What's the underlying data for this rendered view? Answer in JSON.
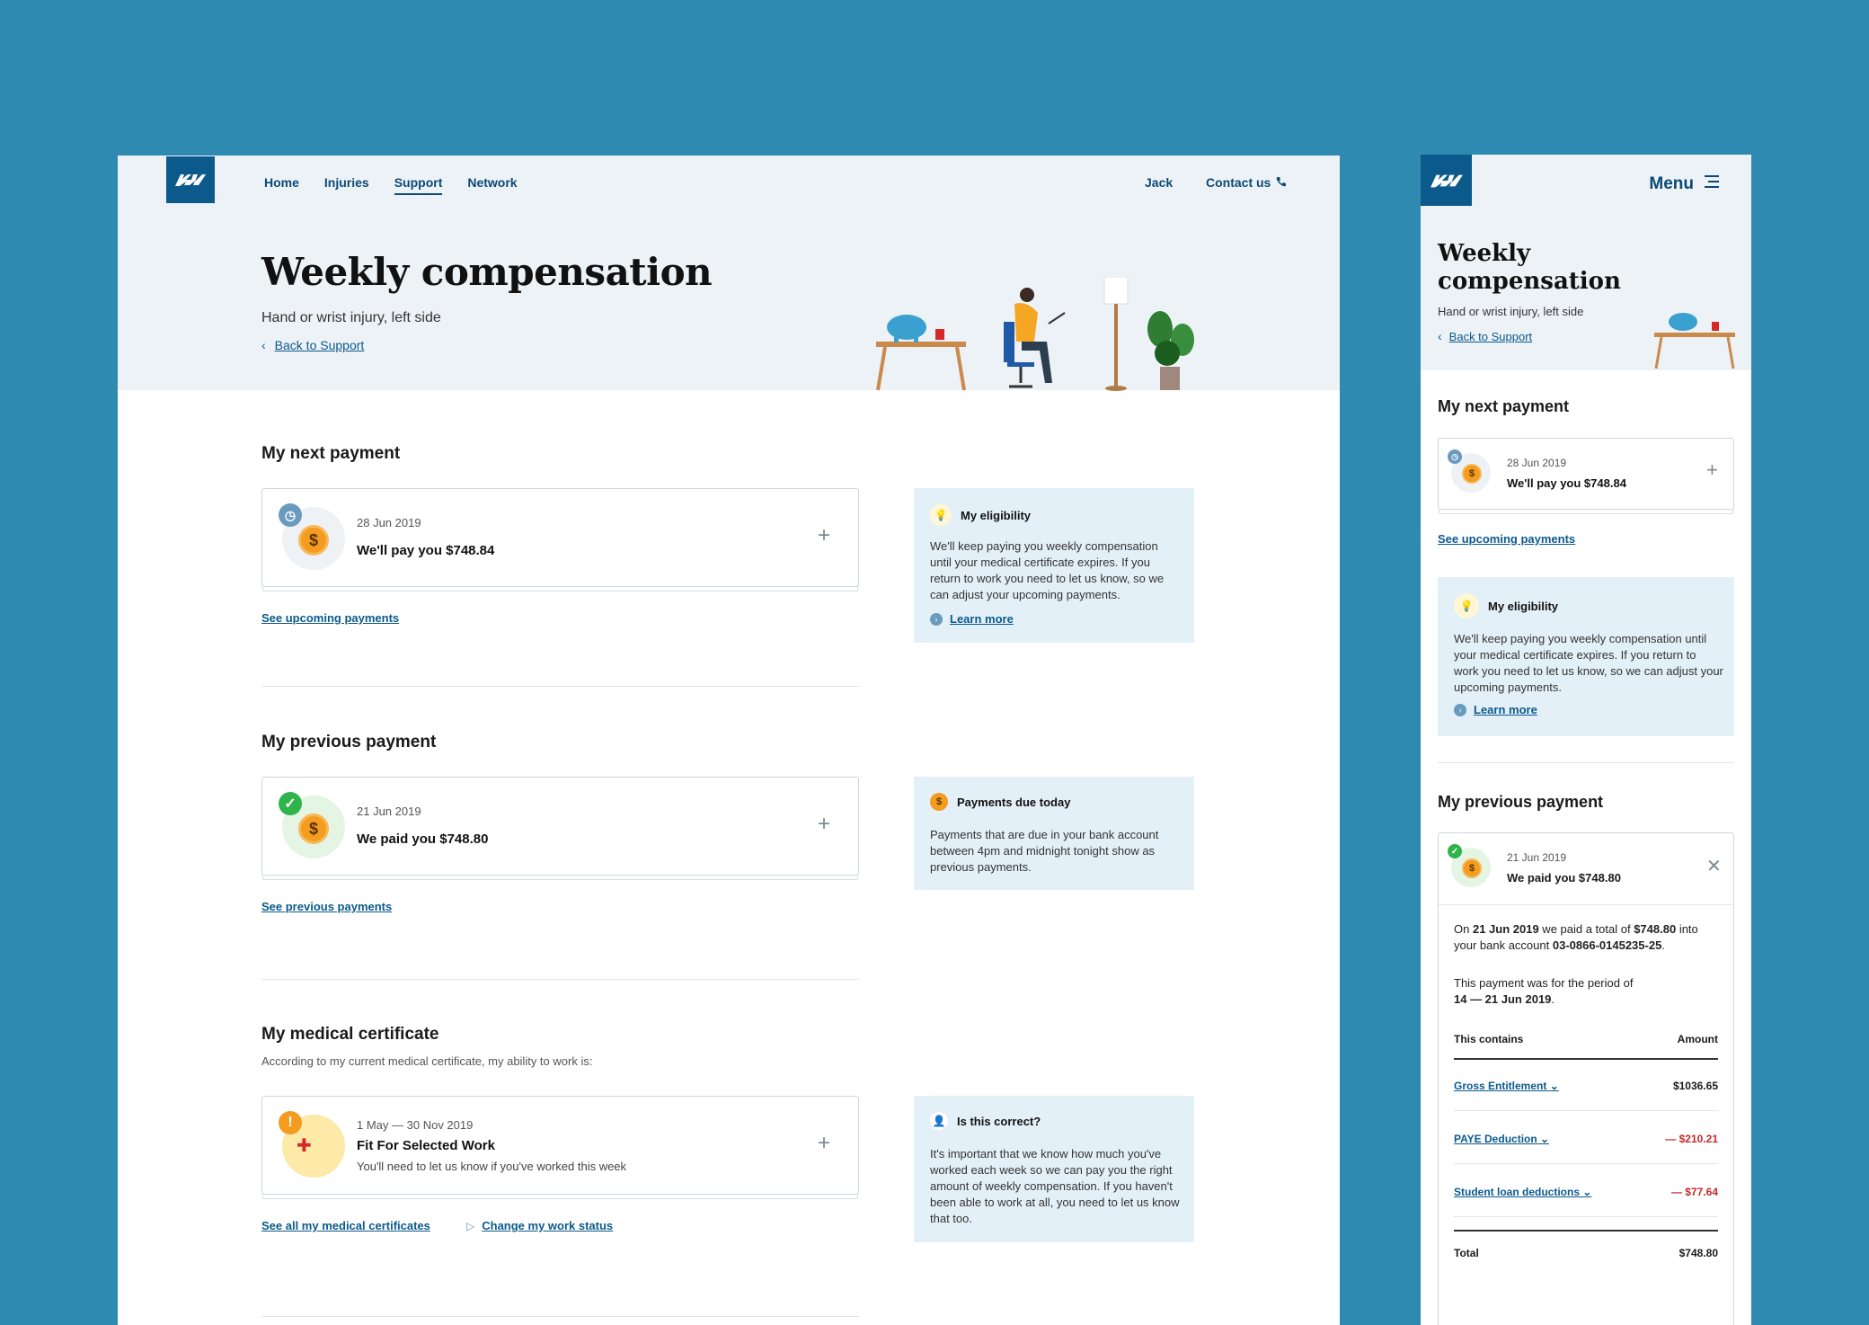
{
  "desktop": {
    "nav": {
      "home": "Home",
      "injuries": "Injuries",
      "support": "Support",
      "network": "Network"
    },
    "user": "Jack",
    "contact": "Contact us",
    "title": "Weekly compensation",
    "subtitle": "Hand or wrist injury, left side",
    "back": "Back to Support",
    "next_payment": {
      "heading": "My next payment",
      "date": "28 Jun 2019",
      "amount": "We'll pay you $748.84",
      "link": "See upcoming payments"
    },
    "eligibility": {
      "heading": "My eligibility",
      "body": "We'll keep paying you weekly compensation until your medical certificate expires. If you return to work you need to let us know, so we can adjust your upcoming payments.",
      "link": "Learn more"
    },
    "previous_payment": {
      "heading": "My previous payment",
      "date": "21 Jun 2019",
      "amount": "We paid you $748.80",
      "link": "See previous payments"
    },
    "due_today": {
      "heading": "Payments due today",
      "body": "Payments that are due in your bank account between 4pm and midnight tonight show as previous payments."
    },
    "medical": {
      "heading": "My medical certificate",
      "intro": "According to my current medical certificate, my ability to work is:",
      "dates": "1 May — 30 Nov 2019",
      "status": "Fit For Selected Work",
      "note": "You'll need to let us know if you've worked this week",
      "link_all": "See all my medical certificates",
      "link_change": "Change my work status"
    },
    "correct": {
      "heading": "Is this correct?",
      "body": "It's important that we know how much you've worked each week so we can pay you the right amount of weekly compensation. If you haven't been able to work at all, you need to let us know that too."
    }
  },
  "mobile": {
    "menu": "Menu",
    "title_line1": "Weekly",
    "title_line2": "compensation",
    "subtitle": "Hand or wrist injury, left side",
    "back": "Back to Support",
    "next_heading": "My next payment",
    "next_date": "28 Jun 2019",
    "next_amount": "We'll pay you $748.84",
    "upcoming_link": "See upcoming payments",
    "elig_heading": "My eligibility",
    "elig_body": "We'll keep paying you weekly compensation until your medical certificate expires. If you return to work you need to let us know, so we can adjust your upcoming payments.",
    "learn_more": "Learn more",
    "prev_heading": "My previous payment",
    "prev_date": "21 Jun 2019",
    "prev_amount": "We paid you $748.80",
    "detail": {
      "on": "On ",
      "date": "21 Jun 2019",
      "mid": " we paid a total of ",
      "total": "$748.80",
      "into": " into your bank account ",
      "account": "03-0866-0145235-25",
      "dot": ".",
      "period_text": "This payment was for the period of",
      "period": "14 — 21 Jun 2019"
    },
    "table": {
      "col1": "This contains",
      "col2": "Amount",
      "rows": [
        {
          "label": "Gross Entitlement",
          "value": "$1036.65"
        },
        {
          "label": "PAYE Deduction",
          "value": "— $210.21"
        },
        {
          "label": "Student loan deductions",
          "value": "— $77.64"
        }
      ],
      "total_label": "Total",
      "total_value": "$748.80"
    }
  },
  "colors": {
    "background": "#2e8ab0",
    "brand": "#0c5a8c",
    "info": "#e3f0f7",
    "coin": "#f39c1f",
    "negative": "#c62828"
  }
}
